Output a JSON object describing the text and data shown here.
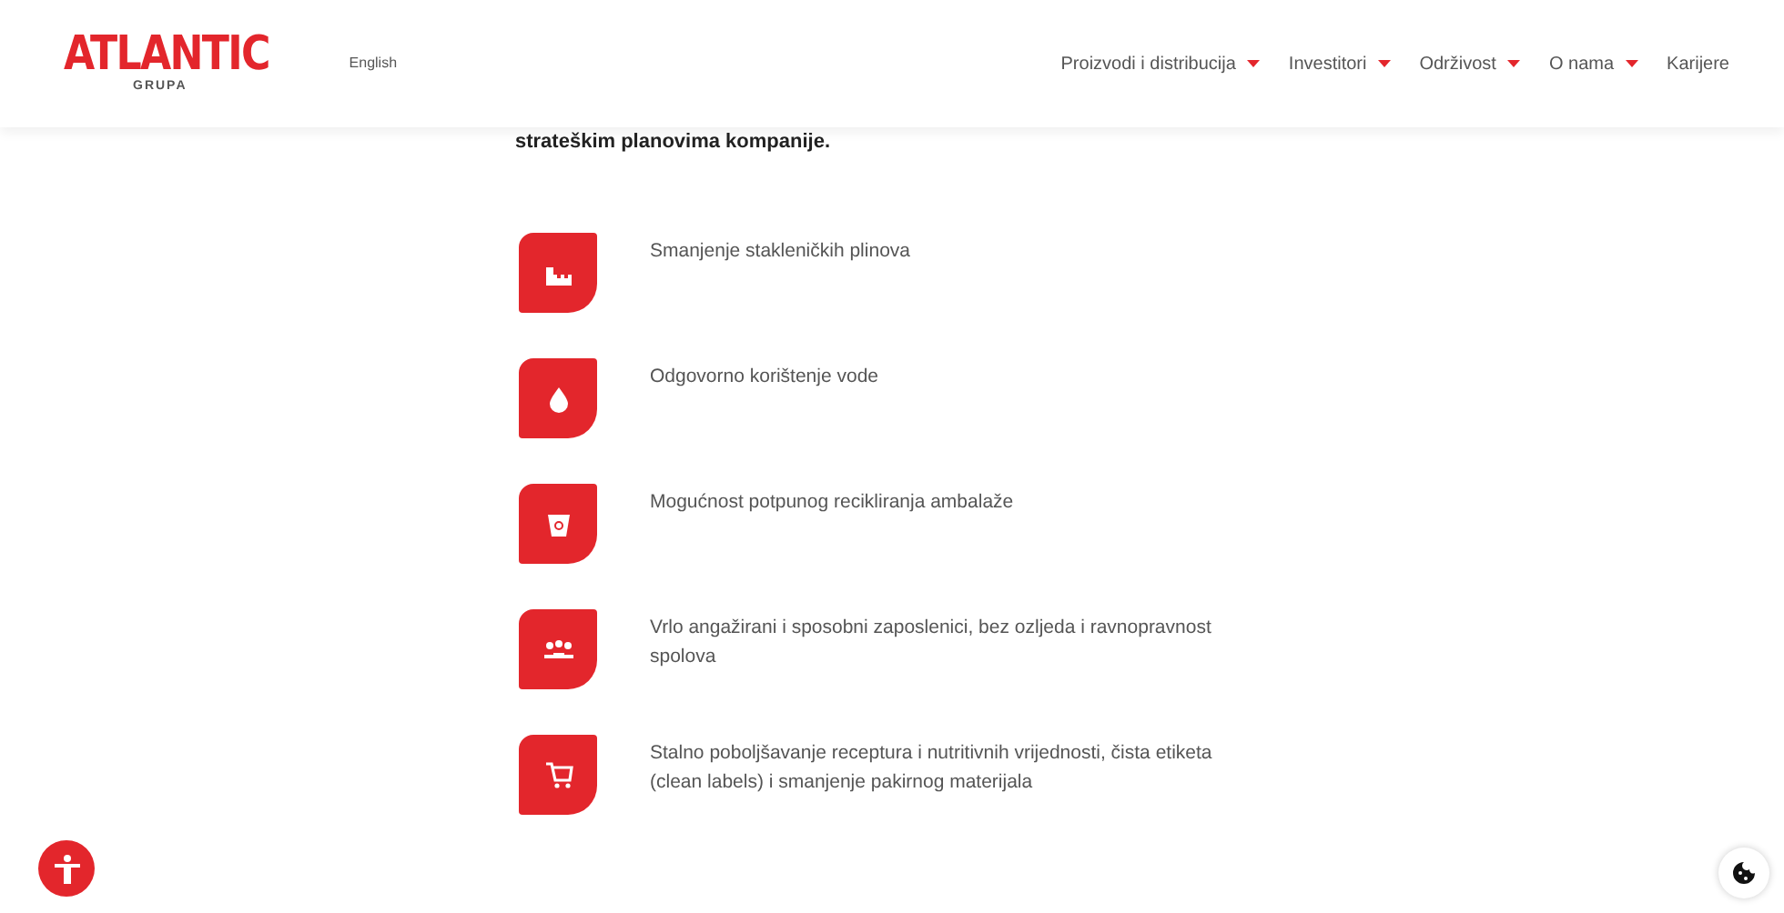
{
  "header": {
    "logo": "ATLANTIC",
    "logo_sub": "GRUPA",
    "language": "English",
    "nav": [
      {
        "label": "Proizvodi i distribucija",
        "dropdown": true
      },
      {
        "label": "Investitori",
        "dropdown": true
      },
      {
        "label": "Održivost",
        "dropdown": true
      },
      {
        "label": "O nama",
        "dropdown": true
      },
      {
        "label": "Karijere",
        "dropdown": false
      }
    ]
  },
  "intro": "strateškim planovima kompanije.",
  "goals": [
    {
      "kind": "factory",
      "text": "Smanjenje stakleničkih plinova"
    },
    {
      "kind": "drop",
      "text": "Odgovorno korištenje vode"
    },
    {
      "kind": "bin",
      "text": "Mogućnost potpunog recikliranja ambalaže"
    },
    {
      "kind": "people",
      "text": "Vrlo angažirani i sposobni zaposlenici, bez ozljeda i ravnopravnost spolova"
    },
    {
      "kind": "cart",
      "text": "Stalno poboljšavanje receptura i nutritivnih vrijednosti, čista etiketa (clean labels) i smanjenje pakirnog materijala"
    }
  ]
}
